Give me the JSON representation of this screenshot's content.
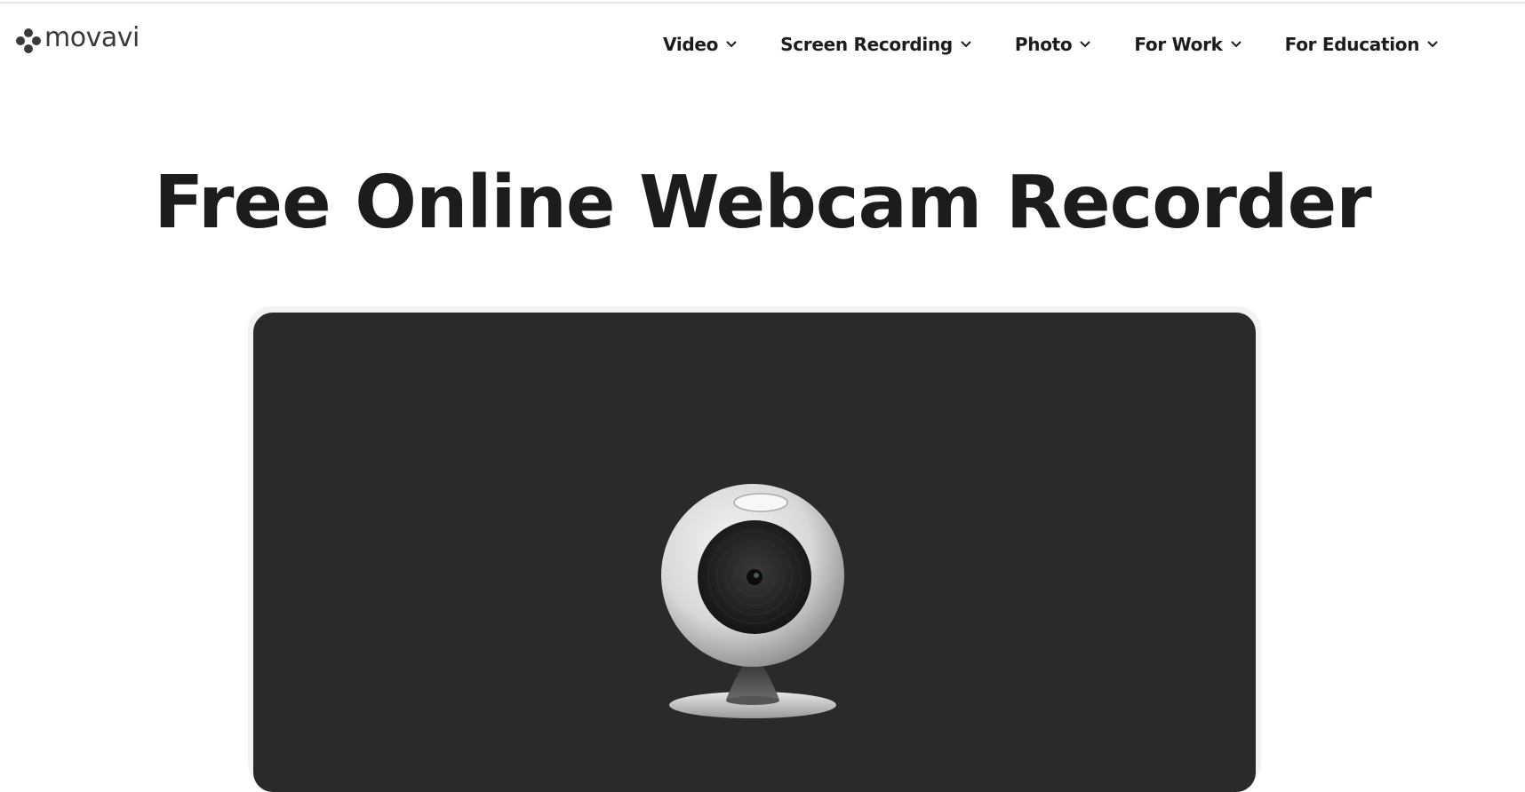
{
  "header": {
    "logo_text": "movavi",
    "nav": [
      {
        "label": "Video",
        "icon": "chevron-down-icon"
      },
      {
        "label": "Screen Recording",
        "icon": "chevron-down-icon"
      },
      {
        "label": "Photo",
        "icon": "chevron-down-icon"
      },
      {
        "label": "For Work",
        "icon": "chevron-down-icon"
      },
      {
        "label": "For Education",
        "icon": "chevron-down-icon"
      }
    ]
  },
  "main": {
    "title": "Free Online Webcam Recorder",
    "preview": {
      "illustration": "webcam-icon",
      "background_color": "#2a2a2a"
    }
  }
}
